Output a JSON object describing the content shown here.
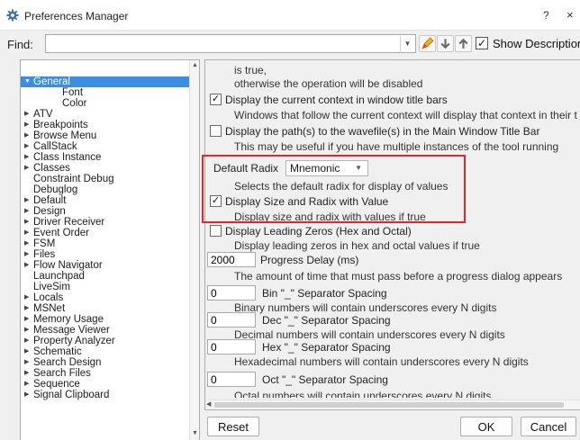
{
  "window": {
    "title": "Preferences Manager",
    "help_label": "?",
    "close_label": "×"
  },
  "find": {
    "label": "Find:",
    "value": "",
    "show_descriptions_label": "Show Descriptions",
    "show_descriptions_checked": true
  },
  "tree": {
    "items": [
      {
        "label": "General",
        "expanded": true,
        "selected": true,
        "level": 0
      },
      {
        "label": "Font",
        "level": 1
      },
      {
        "label": "Color",
        "level": 1
      },
      {
        "label": "ATV",
        "level": 0
      },
      {
        "label": "Breakpoints",
        "level": 0
      },
      {
        "label": "Browse Menu",
        "level": 0
      },
      {
        "label": "CallStack",
        "level": 0
      },
      {
        "label": "Class Instance",
        "level": 0
      },
      {
        "label": "Classes",
        "level": 0
      },
      {
        "label": "Constraint Debug",
        "level": 0,
        "no_arrow": true
      },
      {
        "label": "Debuglog",
        "level": 0,
        "no_arrow": true
      },
      {
        "label": "Default",
        "level": 0
      },
      {
        "label": "Design",
        "level": 0
      },
      {
        "label": "Driver Receiver",
        "level": 0
      },
      {
        "label": "Event Order",
        "level": 0
      },
      {
        "label": "FSM",
        "level": 0
      },
      {
        "label": "Files",
        "level": 0
      },
      {
        "label": "Flow Navigator",
        "level": 0
      },
      {
        "label": "Launchpad",
        "level": 0,
        "no_arrow": true
      },
      {
        "label": "LiveSim",
        "level": 0,
        "no_arrow": true
      },
      {
        "label": "Locals",
        "level": 0
      },
      {
        "label": "MSNet",
        "level": 0
      },
      {
        "label": "Memory Usage",
        "level": 0
      },
      {
        "label": "Message Viewer",
        "level": 0
      },
      {
        "label": "Property Analyzer",
        "level": 0
      },
      {
        "label": "Schematic",
        "level": 0
      },
      {
        "label": "Search Design",
        "level": 0
      },
      {
        "label": "Search Files",
        "level": 0
      },
      {
        "label": "Sequence",
        "level": 0
      },
      {
        "label": "Signal Clipboard",
        "level": 0
      }
    ]
  },
  "options": {
    "line_is_true": "is true,",
    "line_otherwise": "otherwise the operation will be disabled",
    "display_context_label": "Display the current context in window title bars",
    "display_context_checked": true,
    "display_context_desc": "Windows that follow the current context will display that context in their t",
    "display_path_label": "Display the path(s) to the wavefile(s) in the Main Window Title Bar",
    "display_path_checked": false,
    "display_path_desc": "This may be useful if you have multiple instances of the tool running",
    "default_radix_label": "Default Radix",
    "default_radix_value": "Mnemonic",
    "default_radix_desc": "Selects the default radix for display of values",
    "display_size_label": "Display Size and Radix with Value",
    "display_size_checked": true,
    "display_size_desc": "Display size and radix with values if true",
    "leading_zeros_label": "Display Leading Zeros (Hex and Octal)",
    "leading_zeros_checked": false,
    "leading_zeros_desc": "Display leading zeros in hex and octal values if true",
    "progress_delay_value": "2000",
    "progress_delay_label": "Progress Delay (ms)",
    "progress_delay_desc": "The amount of time that must pass before a progress dialog appears",
    "bin_value": "0",
    "bin_label": "Bin \"_\" Separator Spacing",
    "bin_desc": "Binary numbers will contain underscores every N digits",
    "dec_value": "0",
    "dec_label": "Dec \"_\" Separator Spacing",
    "dec_desc": "Decimal numbers will contain underscores every N digits",
    "hex_value": "0",
    "hex_label": "Hex \"_\" Separator Spacing",
    "hex_desc": "Hexadecimal numbers will contain underscores every N digits",
    "oct_value": "0",
    "oct_label": "Oct \"_\" Separator Spacing",
    "oct_desc": "Octal numbers will contain underscores every N digits"
  },
  "buttons": {
    "reset": "Reset",
    "ok": "OK",
    "cancel": "Cancel"
  },
  "colors": {
    "selection": "#3a8ee6",
    "highlight_border": "#e0282c"
  },
  "icons": {
    "app": "gear-icon",
    "dropdown": "chevron-down-icon",
    "highlight": "pencil-icon",
    "down": "arrow-down-icon",
    "up": "arrow-up-icon"
  }
}
